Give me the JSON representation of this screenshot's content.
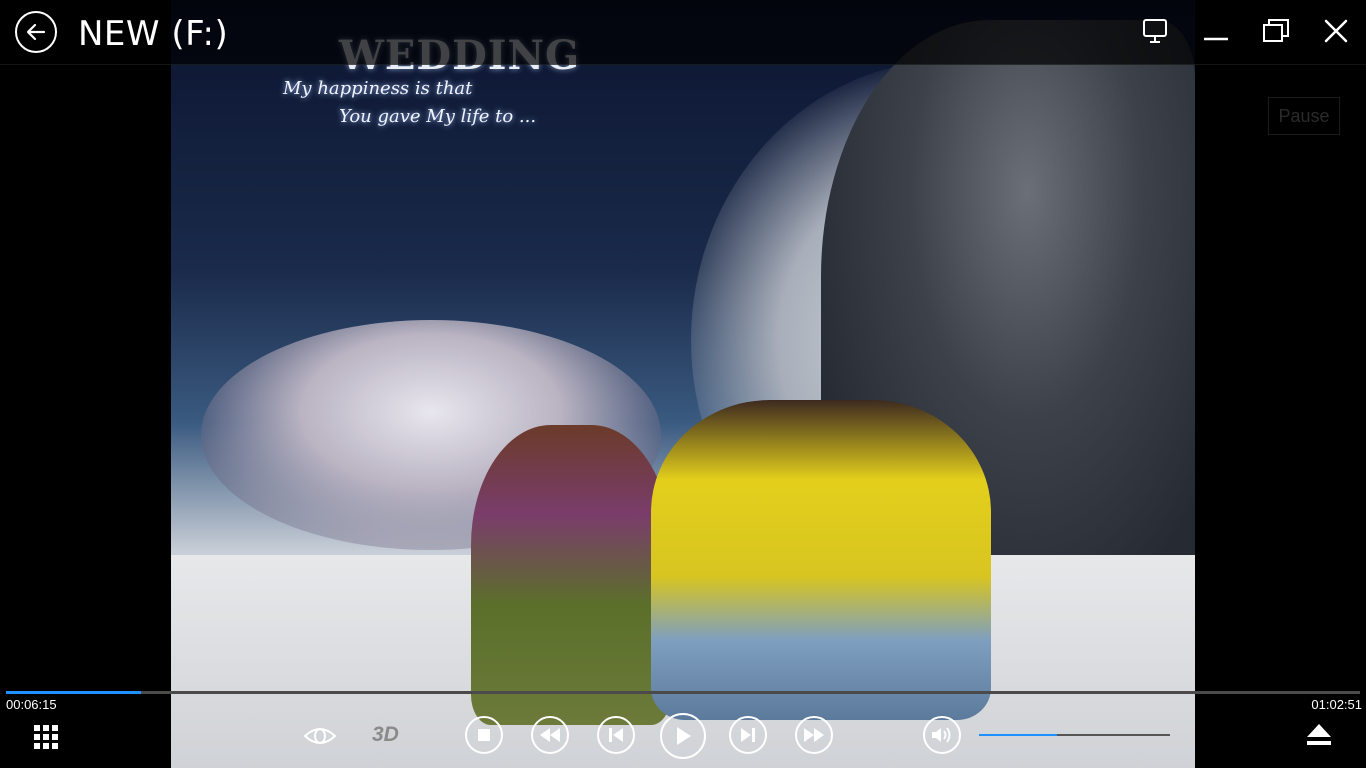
{
  "window": {
    "title": "NEW (F:)",
    "back_icon": "back-arrow-icon",
    "buttons": [
      {
        "name": "display-mode-button",
        "icon": "monitor-icon"
      },
      {
        "name": "minimize-button",
        "icon": "minimize-icon"
      },
      {
        "name": "restore-button",
        "icon": "restore-icon"
      },
      {
        "name": "close-button",
        "icon": "close-icon"
      }
    ]
  },
  "video": {
    "overlay_title": "WEDDING",
    "tagline_line1": "My happiness is that",
    "tagline_line2": "You gave My life to ...",
    "state_label": "Pause"
  },
  "playback": {
    "elapsed": "00:06:15",
    "total": "01:02:51",
    "progress_fraction": 0.1
  },
  "controls": {
    "playlist_icon": "grid-icon",
    "eye_icon": "eye-icon",
    "mode_3d_label": "3D",
    "stop_icon": "stop-icon",
    "rewind_icon": "rewind-icon",
    "previous_icon": "previous-icon",
    "play_icon": "play-icon",
    "next_icon": "next-icon",
    "fast_forward_icon": "fast-forward-icon",
    "volume_icon": "speaker-icon",
    "volume_fraction": 0.41,
    "eject_icon": "eject-icon"
  },
  "colors": {
    "accent": "#1e90ff",
    "background": "#000000",
    "foreground": "#ffffff",
    "disabled": "#8a8a8a"
  }
}
